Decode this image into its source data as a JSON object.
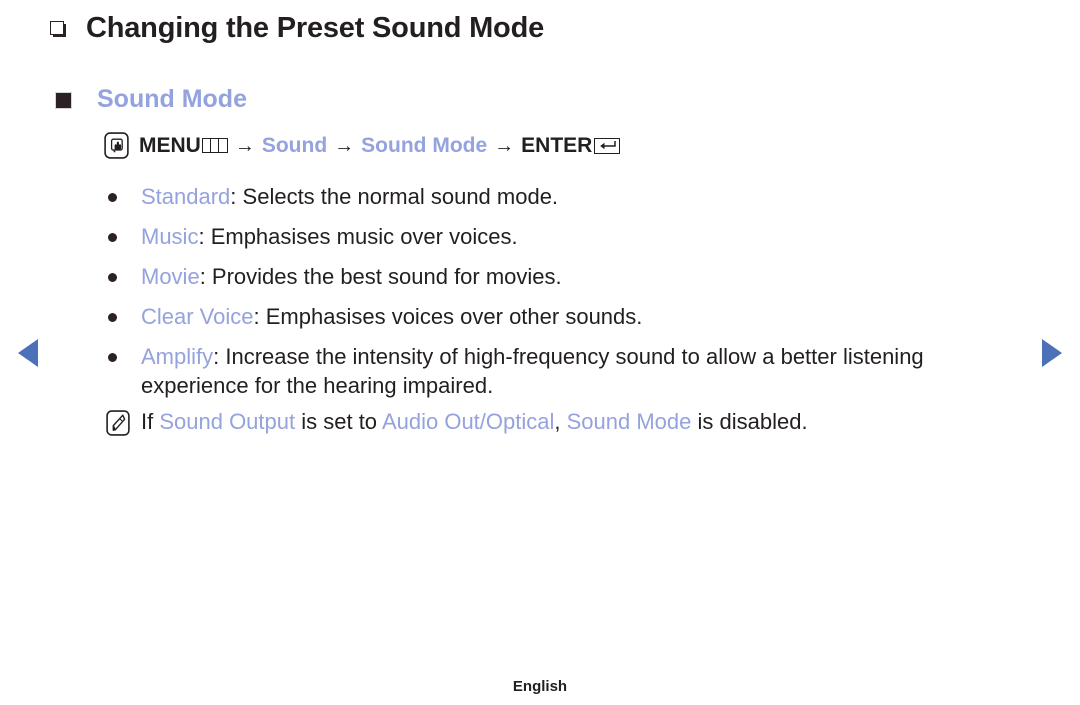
{
  "page": {
    "title": "Changing the Preset Sound Mode",
    "section_heading": "Sound Mode",
    "footer_language": "English",
    "accent_color": "#94a2de",
    "text_color": "#231f20",
    "arrow_color": "#4d71b8"
  },
  "menu_path": {
    "icon": "oo-press-icon",
    "menu_label": "MENU",
    "menu_glyph": "menu-keys-icon",
    "arrow": "→",
    "step1": "Sound",
    "step2": "Sound Mode",
    "enter_label": "ENTER",
    "enter_glyph": "enter-return-icon"
  },
  "modes": [
    {
      "name": "Standard",
      "separator": ": ",
      "description": "Selects the normal sound mode."
    },
    {
      "name": "Music",
      "separator": ": ",
      "description": "Emphasises music over voices."
    },
    {
      "name": "Movie",
      "separator": ": ",
      "description": "Provides the best sound for movies."
    },
    {
      "name": "Clear Voice",
      "separator": ": ",
      "description": "Emphasises voices over other sounds."
    },
    {
      "name": "Amplify",
      "separator": ": ",
      "description": "Increase the intensity of high-frequency sound to allow a better listening experience for the hearing impaired."
    }
  ],
  "note": {
    "icon": "nn-note-icon",
    "part1": "If ",
    "kw1": "Sound Output",
    "part2": " is set to ",
    "kw2": "Audio Out/Optical",
    "part3": ", ",
    "kw3": "Sound Mode",
    "part4": " is disabled."
  },
  "nav": {
    "prev_label": "Previous page",
    "next_label": "Next page"
  }
}
